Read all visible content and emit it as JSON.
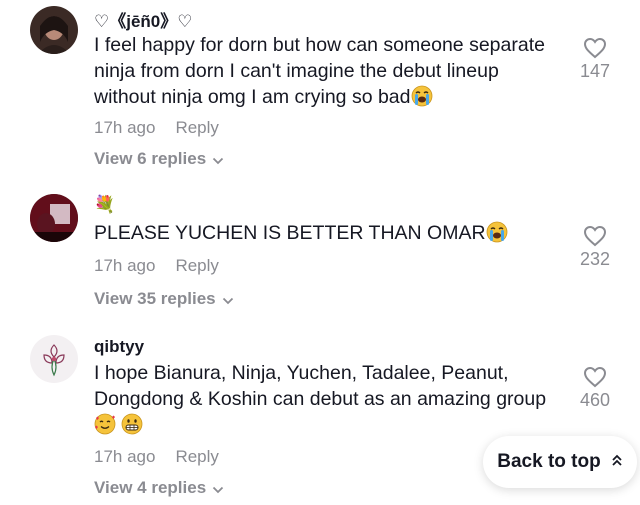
{
  "comments": [
    {
      "username": "♡《jēñ0》♡",
      "text": "I feel happy for dorn but how can someone separate ninja from dorn I can't imagine the debut lineup without ninja omg I am crying so bad",
      "time": "17h ago",
      "reply_label": "Reply",
      "view_replies": "View 6 replies",
      "likes": "147",
      "emojis": [
        "loudly-crying-face"
      ]
    },
    {
      "username": "💐",
      "text": "PLEASE YUCHEN IS BETTER THAN OMAR",
      "time": "17h ago",
      "reply_label": "Reply",
      "view_replies": "View 35 replies",
      "likes": "232",
      "emojis": [
        "loudly-crying-face"
      ]
    },
    {
      "username": "qibtyy",
      "text": "I hope Bianura, Ninja, Yuchen, Tadalee, Peanut, Dongdong & Koshin can debut as an amazing group",
      "time": "17h ago",
      "reply_label": "Reply",
      "view_replies": "View 4 replies",
      "likes": "460",
      "emojis": [
        "smiling-face-with-hearts",
        "grinning-face"
      ]
    }
  ],
  "back_to_top": "Back to top",
  "colors": {
    "secondary_text": "#8a8b91",
    "primary_text": "#161823",
    "emoji_yellow": "#f5c33b"
  }
}
